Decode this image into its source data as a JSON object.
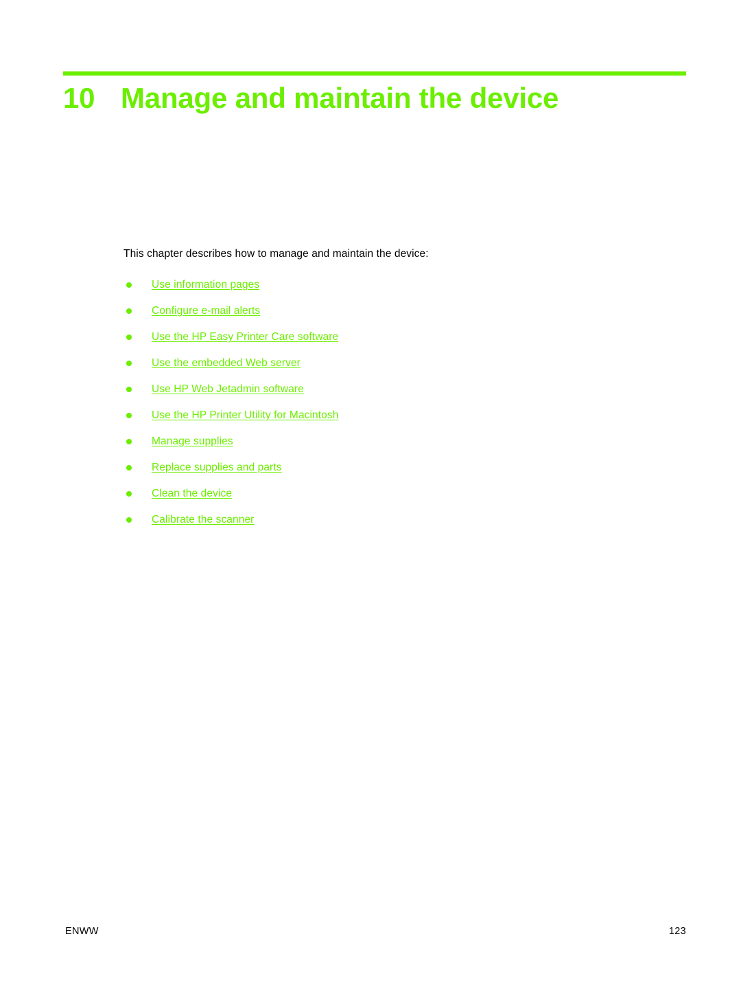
{
  "page": {
    "background_color": "#ffffff",
    "accent_color": "#6BEE00",
    "text_color": "#000000"
  },
  "chapter": {
    "number": "10",
    "title": "Manage and maintain the device"
  },
  "body": {
    "intro": "This chapter describes how to manage and maintain the device:"
  },
  "toc": {
    "items": [
      {
        "label": "Use information pages"
      },
      {
        "label": "Configure e-mail alerts"
      },
      {
        "label": "Use the HP Easy Printer Care software"
      },
      {
        "label": "Use the embedded Web server"
      },
      {
        "label": "Use HP Web Jetadmin software"
      },
      {
        "label": "Use the HP Printer Utility for Macintosh"
      },
      {
        "label": "Manage supplies"
      },
      {
        "label": "Replace supplies and parts"
      },
      {
        "label": "Clean the device"
      },
      {
        "label": "Calibrate the scanner"
      }
    ]
  },
  "footer": {
    "locale": "ENWW",
    "page_number": "123"
  }
}
